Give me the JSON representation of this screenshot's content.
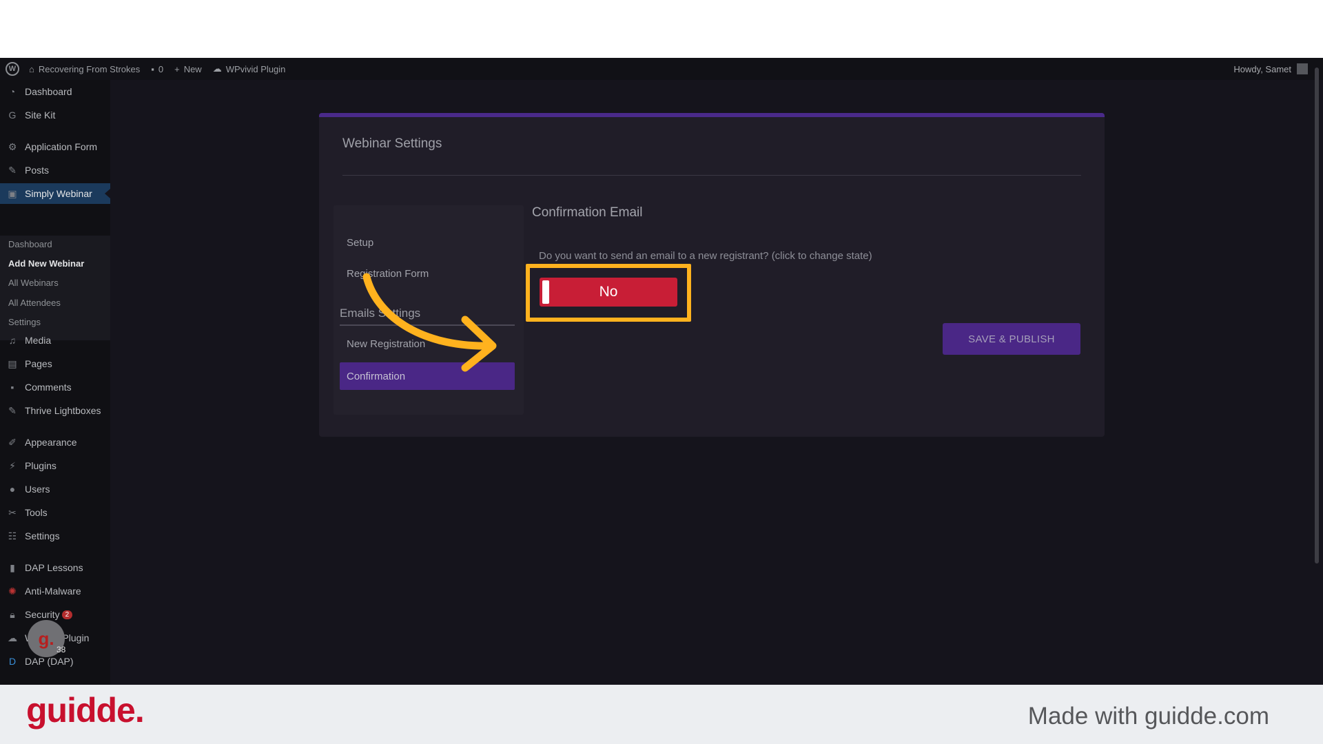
{
  "adminbar": {
    "site_name": "Recovering From Strokes",
    "comments_count": "0",
    "new_label": "New",
    "plugin_label": "WPvivid Plugin",
    "howdy": "Howdy, Samet"
  },
  "sidebar": {
    "items": [
      {
        "label": "Dashboard",
        "icon": "dashboard-icon"
      },
      {
        "label": "Site Kit",
        "icon": "google-icon"
      },
      {
        "label": "Application Form",
        "icon": "gear-icon"
      },
      {
        "label": "Posts",
        "icon": "pin-icon"
      },
      {
        "label": "Simply Webinar",
        "icon": "webinar-icon"
      },
      {
        "label": "Media",
        "icon": "media-icon"
      },
      {
        "label": "Pages",
        "icon": "pages-icon"
      },
      {
        "label": "Comments",
        "icon": "comment-icon"
      },
      {
        "label": "Thrive Lightboxes",
        "icon": "pin-icon"
      },
      {
        "label": "Appearance",
        "icon": "brush-icon"
      },
      {
        "label": "Plugins",
        "icon": "plugin-icon"
      },
      {
        "label": "Users",
        "icon": "user-icon"
      },
      {
        "label": "Tools",
        "icon": "wrench-icon"
      },
      {
        "label": "Settings",
        "icon": "settings-icon"
      },
      {
        "label": "DAP Lessons",
        "icon": "book-icon"
      },
      {
        "label": "Anti-Malware",
        "icon": "shield-icon"
      },
      {
        "label": "Security",
        "icon": "lock-icon",
        "badge": "2"
      },
      {
        "label": "WPvivid Plugin",
        "icon": "cloud-icon"
      },
      {
        "label": "DAP (DAP)",
        "icon": "dap-icon"
      }
    ],
    "submenu": [
      "Dashboard",
      "Add New Webinar",
      "All Webinars",
      "All Attendees",
      "Settings"
    ]
  },
  "card": {
    "title": "Webinar Settings",
    "tabs": {
      "setup": "Setup",
      "registration_form": "Registration Form",
      "section": "Emails Settings",
      "new_registration": "New Registration",
      "confirmation": "Confirmation"
    },
    "content_title": "Confirmation Email",
    "question": "Do you want to send an email to a new registrant? (click to change state)",
    "toggle_label": "No",
    "save_button": "SAVE & PUBLISH"
  },
  "guidde": {
    "avatar_letter": "g.",
    "count": "38",
    "logo": "guidde.",
    "made_with": "Made with guidde.com"
  },
  "colors": {
    "accent": "#4a2786",
    "toggle_off": "#c81e36",
    "highlight": "#ffb21e",
    "brand": "#c8102e"
  }
}
